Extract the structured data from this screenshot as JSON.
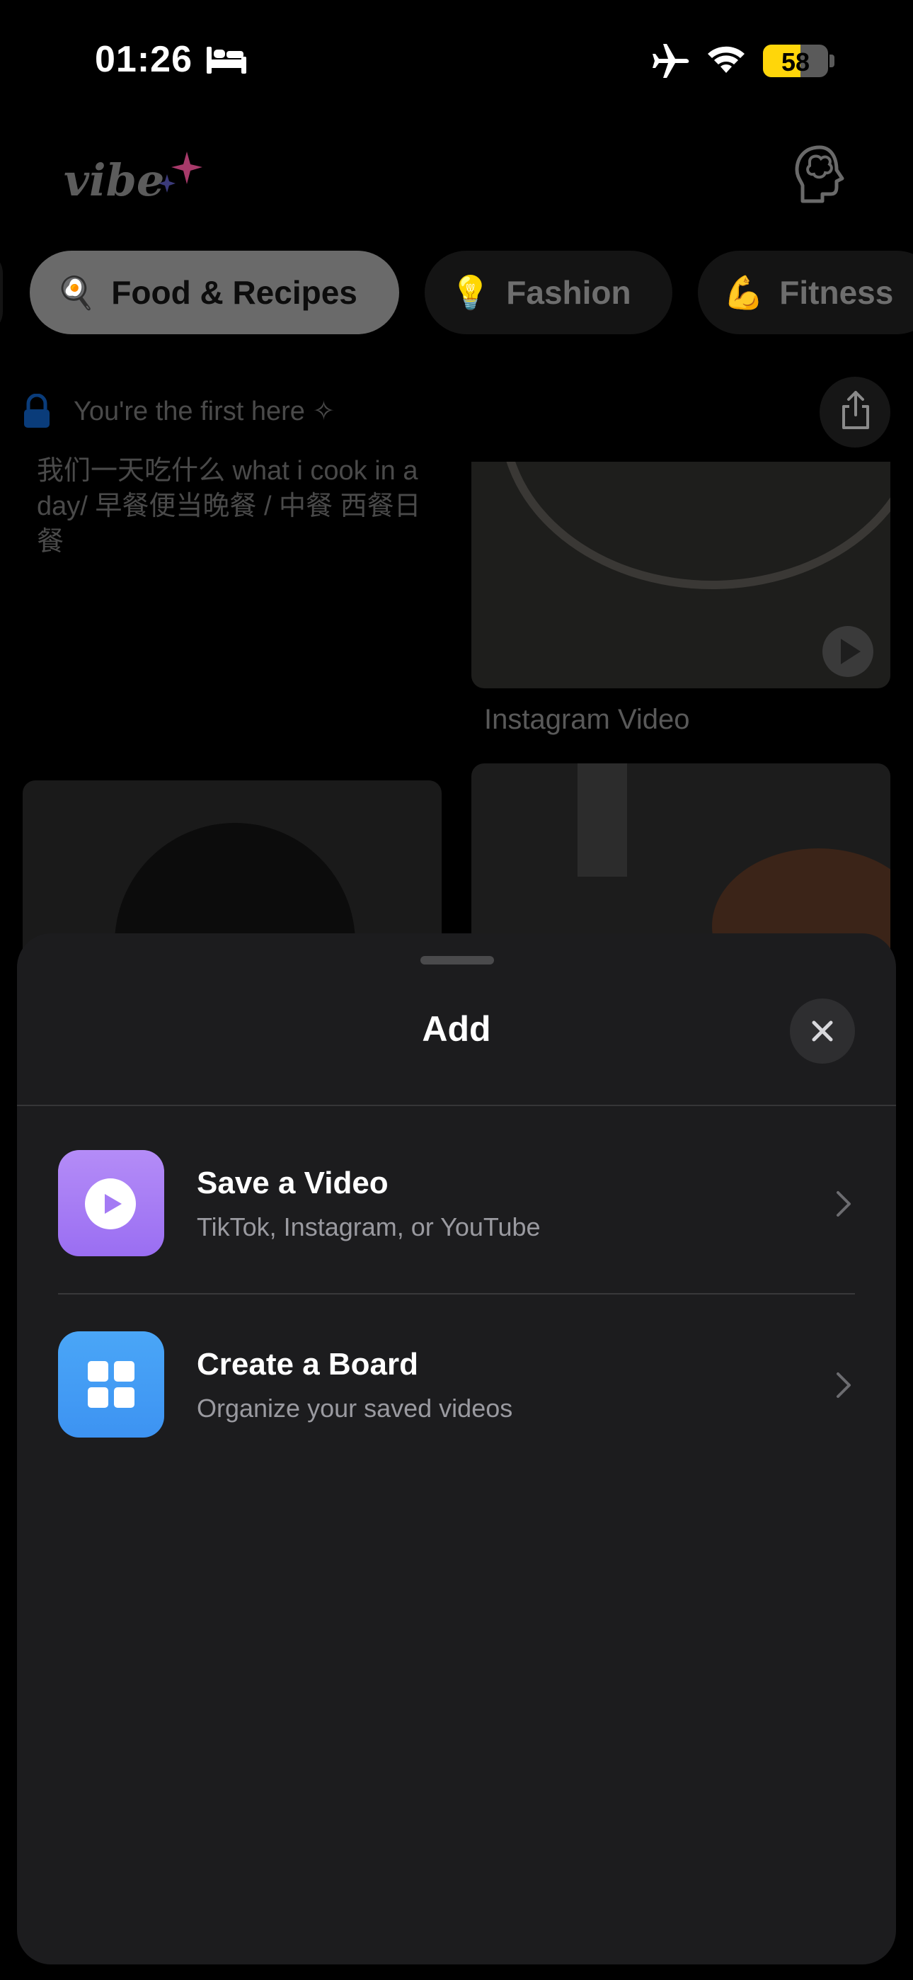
{
  "status_bar": {
    "time": "01:26",
    "battery": "58",
    "battery_level": 0.58,
    "focus_icon": "bed-icon",
    "airplane_mode": true,
    "wifi": true
  },
  "header": {
    "logo_text": "vibe",
    "logo_sparkle_icon": "sparkle-icon",
    "profile_icon": "brain-head-icon"
  },
  "categories": [
    {
      "emoji": "🍳",
      "label": "Food & Recipes",
      "selected": true
    },
    {
      "emoji": "💡",
      "label": "Fashion",
      "selected": false
    },
    {
      "emoji": "💪",
      "label": "Fitness",
      "selected": false
    }
  ],
  "feed": {
    "status_text": "You're the first here ✧",
    "cards": [
      {
        "caption": "我们一天吃什么 what i cook in a day/ 早餐便当晚餐 / 中餐 西餐日餐"
      },
      {
        "caption": "Instagram Video"
      }
    ]
  },
  "sheet": {
    "title": "Add",
    "options": [
      {
        "title": "Save a Video",
        "subtitle": "TikTok, Instagram, or YouTube",
        "icon": "play-circle-icon",
        "color": "#a97cf5"
      },
      {
        "title": "Create a Board",
        "subtitle": "Organize your saved videos",
        "icon": "grid-icon",
        "color": "#45a0f5"
      }
    ]
  },
  "colors": {
    "sheet_bg": "#1c1c1e",
    "background": "#000000",
    "battery": "#ffd60a"
  }
}
